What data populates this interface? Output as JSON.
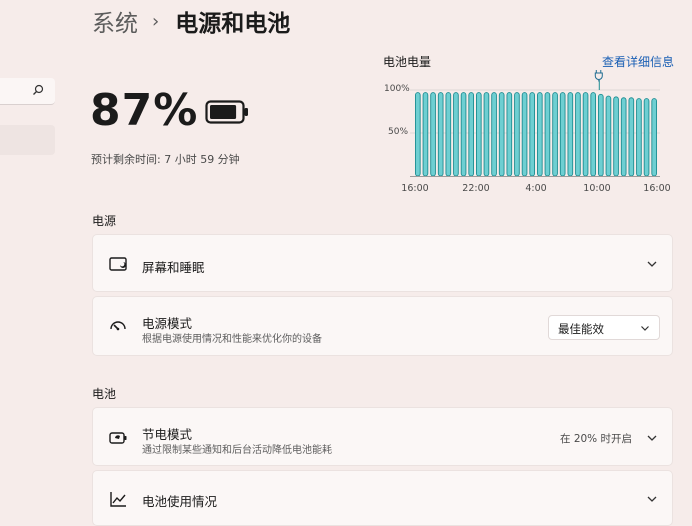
{
  "header": {
    "parent": "系统",
    "separator": "›",
    "current": "电源和电池"
  },
  "battery": {
    "percent_text": "87%",
    "level": 0.87,
    "remaining": "预计剩余时间: 7 小时 59 分钟"
  },
  "chart_data": {
    "type": "bar",
    "title": "电池电量",
    "link": "查看详细信息",
    "y_ticks": [
      "100%",
      "50%"
    ],
    "x_ticks": [
      "16:00",
      "22:00",
      "4:00",
      "10:00",
      "16:00"
    ],
    "ylim": [
      0,
      100
    ],
    "values": [
      97,
      97,
      97,
      97,
      97,
      97,
      97,
      97,
      97,
      97,
      97,
      97,
      97,
      97,
      97,
      97,
      97,
      97,
      97,
      97,
      97,
      97,
      97,
      97,
      95,
      93,
      92,
      91,
      91,
      90,
      90,
      90
    ],
    "marker": "plug-icon",
    "colors": {
      "bar_fill": "#6ecfd2",
      "bar_stroke": "#1f8d92",
      "axis": "#9c9c9c"
    }
  },
  "power": {
    "section_title": "电源",
    "screen_sleep": {
      "title": "屏幕和睡眠"
    },
    "power_mode": {
      "title": "电源模式",
      "subtitle": "根据电源使用情况和性能来优化你的设备",
      "selected": "最佳能效"
    }
  },
  "battery_section": {
    "section_title": "电池",
    "saver": {
      "title": "节电模式",
      "subtitle": "通过限制某些通知和后台活动降低电池能耗",
      "status": "在 20% 时开启"
    },
    "usage": {
      "title": "电池使用情况"
    }
  },
  "icons": {
    "search": "search-icon",
    "battery": "battery-icon",
    "screen": "screen-sleep-icon",
    "power_mode": "power-mode-icon",
    "saver": "battery-saver-icon",
    "usage": "usage-chart-icon",
    "chevron": "chevron-down-icon"
  },
  "colors": {
    "accent": "#1a5fb4",
    "background": "#f6ecea",
    "card": "#fbf7f6"
  }
}
